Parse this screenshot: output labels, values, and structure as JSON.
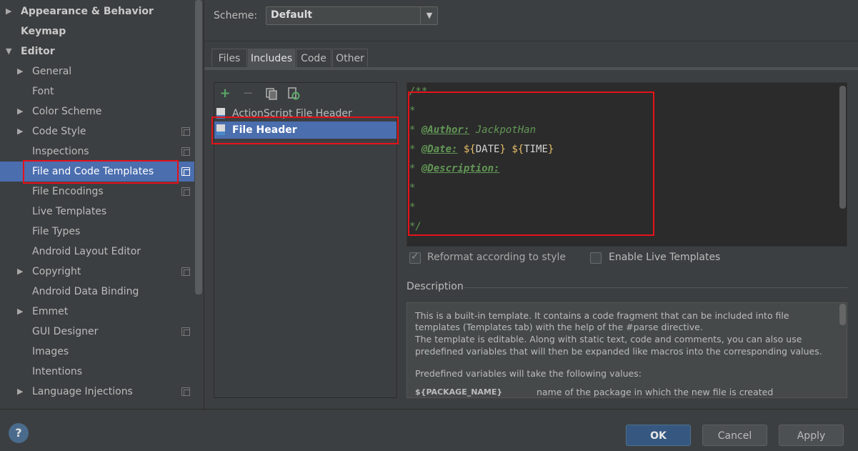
{
  "sidebar": {
    "items": [
      {
        "label": "Appearance & Behavior",
        "arrow": "▶",
        "bold": true
      },
      {
        "label": "Keymap",
        "arrow": "",
        "bold": true
      },
      {
        "label": "Editor",
        "arrow": "▼",
        "bold": true
      },
      {
        "label": "General",
        "arrow": "▶"
      },
      {
        "label": "Font",
        "arrow": ""
      },
      {
        "label": "Color Scheme",
        "arrow": "▶"
      },
      {
        "label": "Code Style",
        "arrow": "▶"
      },
      {
        "label": "Inspections",
        "arrow": ""
      },
      {
        "label": "File and Code Templates",
        "arrow": "",
        "selected": true
      },
      {
        "label": "File Encodings",
        "arrow": ""
      },
      {
        "label": "Live Templates",
        "arrow": ""
      },
      {
        "label": "File Types",
        "arrow": ""
      },
      {
        "label": "Android Layout Editor",
        "arrow": ""
      },
      {
        "label": "Copyright",
        "arrow": "▶"
      },
      {
        "label": "Android Data Binding",
        "arrow": ""
      },
      {
        "label": "Emmet",
        "arrow": "▶"
      },
      {
        "label": "GUI Designer",
        "arrow": ""
      },
      {
        "label": "Images",
        "arrow": ""
      },
      {
        "label": "Intentions",
        "arrow": ""
      },
      {
        "label": "Language Injections",
        "arrow": "▶"
      }
    ]
  },
  "scheme": {
    "label": "Scheme:",
    "value": "Default",
    "arrow": "▼"
  },
  "tabs": [
    {
      "label": "Files"
    },
    {
      "label": "Includes",
      "active": true
    },
    {
      "label": "Code"
    },
    {
      "label": "Other"
    }
  ],
  "toolbar": {
    "add": "+",
    "remove": "−",
    "copy_icon": "copy-icon",
    "reset_icon": "reset-icon"
  },
  "templates": [
    {
      "label": "ActionScript File Header"
    },
    {
      "label": "File Header",
      "selected": true
    }
  ],
  "editor": {
    "lines": [
      {
        "parts": [
          {
            "t": "/**",
            "c": "c-comment"
          }
        ]
      },
      {
        "parts": [
          {
            "t": "*",
            "c": "c-comment"
          }
        ]
      },
      {
        "parts": [
          {
            "t": "* ",
            "c": "c-comment"
          },
          {
            "t": "@Author:",
            "c": "c-tag"
          },
          {
            "t": " JackpotHan",
            "c": "c-comment"
          }
        ]
      },
      {
        "parts": [
          {
            "t": "* ",
            "c": "c-comment"
          },
          {
            "t": "@Date:",
            "c": "c-tag"
          },
          {
            "t": " ${",
            "c": "c-fn"
          },
          {
            "t": "DATE",
            "c": "c-var"
          },
          {
            "t": "}",
            "c": "c-fn"
          },
          {
            "t": " ${",
            "c": "c-fn"
          },
          {
            "t": "TIME",
            "c": "c-var"
          },
          {
            "t": "}",
            "c": "c-fn"
          }
        ]
      },
      {
        "parts": [
          {
            "t": "* ",
            "c": "c-comment"
          },
          {
            "t": "@Description:",
            "c": "c-tag"
          }
        ]
      },
      {
        "parts": [
          {
            "t": "*",
            "c": "c-comment"
          }
        ]
      },
      {
        "parts": [
          {
            "t": "*",
            "c": "c-comment"
          }
        ]
      },
      {
        "parts": [
          {
            "t": "*/",
            "c": "c-comment"
          }
        ]
      }
    ]
  },
  "options": {
    "reformat_label": "Reformat according to style",
    "reformat_checked": true,
    "live_label": "Enable Live Templates",
    "live_checked": false
  },
  "description": {
    "title": "Description",
    "lines": [
      "This is a built-in template. It contains a code fragment that can be included into file",
      "templates (Templates tab) with the help of the #parse directive.",
      "The template is editable. Along with static text, code and comments, you can also use",
      "predefined variables that will then be expanded like macros into the corresponding values.",
      "",
      "Predefined variables will take the following values:"
    ],
    "var_name": "${PACKAGE_NAME}",
    "var_desc": "name of the package in which the new file is created"
  },
  "footer": {
    "help": "?",
    "ok": "OK",
    "cancel": "Cancel",
    "apply": "Apply"
  },
  "colors": {
    "selection": "#4b6eaf",
    "highlight": "#e5121a",
    "comment": "#629755",
    "ok_button": "#365880"
  }
}
